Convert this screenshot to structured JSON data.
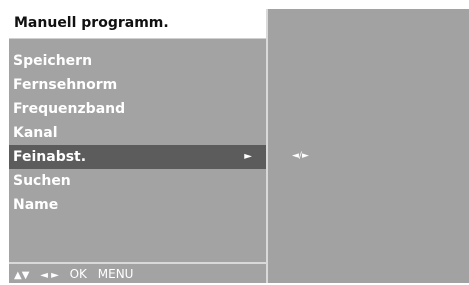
{
  "menu": {
    "title": "Manuell programm.",
    "items": [
      {
        "label": "Speichern"
      },
      {
        "label": "Fernsehnorm"
      },
      {
        "label": "Frequenzband"
      },
      {
        "label": "Kanal"
      },
      {
        "label": "Feinabst.",
        "arrow": "►"
      },
      {
        "label": "Suchen"
      },
      {
        "label": "Name"
      }
    ],
    "selected_index": 4
  },
  "value_panel": {
    "indicator": "◄/►"
  },
  "footer": {
    "updown": "▲▼",
    "leftright": "◄ ►",
    "ok": "OK",
    "menu": "MENU"
  }
}
